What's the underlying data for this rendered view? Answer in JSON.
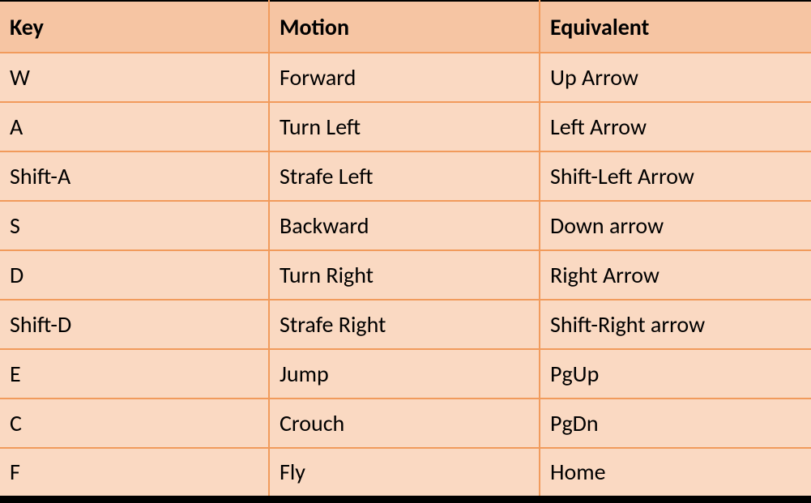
{
  "chart_data": {
    "type": "table",
    "columns": [
      "Key",
      "Motion",
      "Equivalent"
    ],
    "rows": [
      [
        "W",
        "Forward",
        "Up Arrow"
      ],
      [
        "A",
        "Turn Left",
        "Left Arrow"
      ],
      [
        "Shift-A",
        "Strafe Left",
        "Shift-Left Arrow"
      ],
      [
        "S",
        "Backward",
        "Down arrow"
      ],
      [
        "D",
        "Turn Right",
        "Right Arrow"
      ],
      [
        "Shift-D",
        "Strafe Right",
        "Shift-Right arrow"
      ],
      [
        "E",
        "Jump",
        "PgUp"
      ],
      [
        "C",
        "Crouch",
        "PgDn"
      ],
      [
        "F",
        "Fly",
        "Home"
      ]
    ]
  }
}
